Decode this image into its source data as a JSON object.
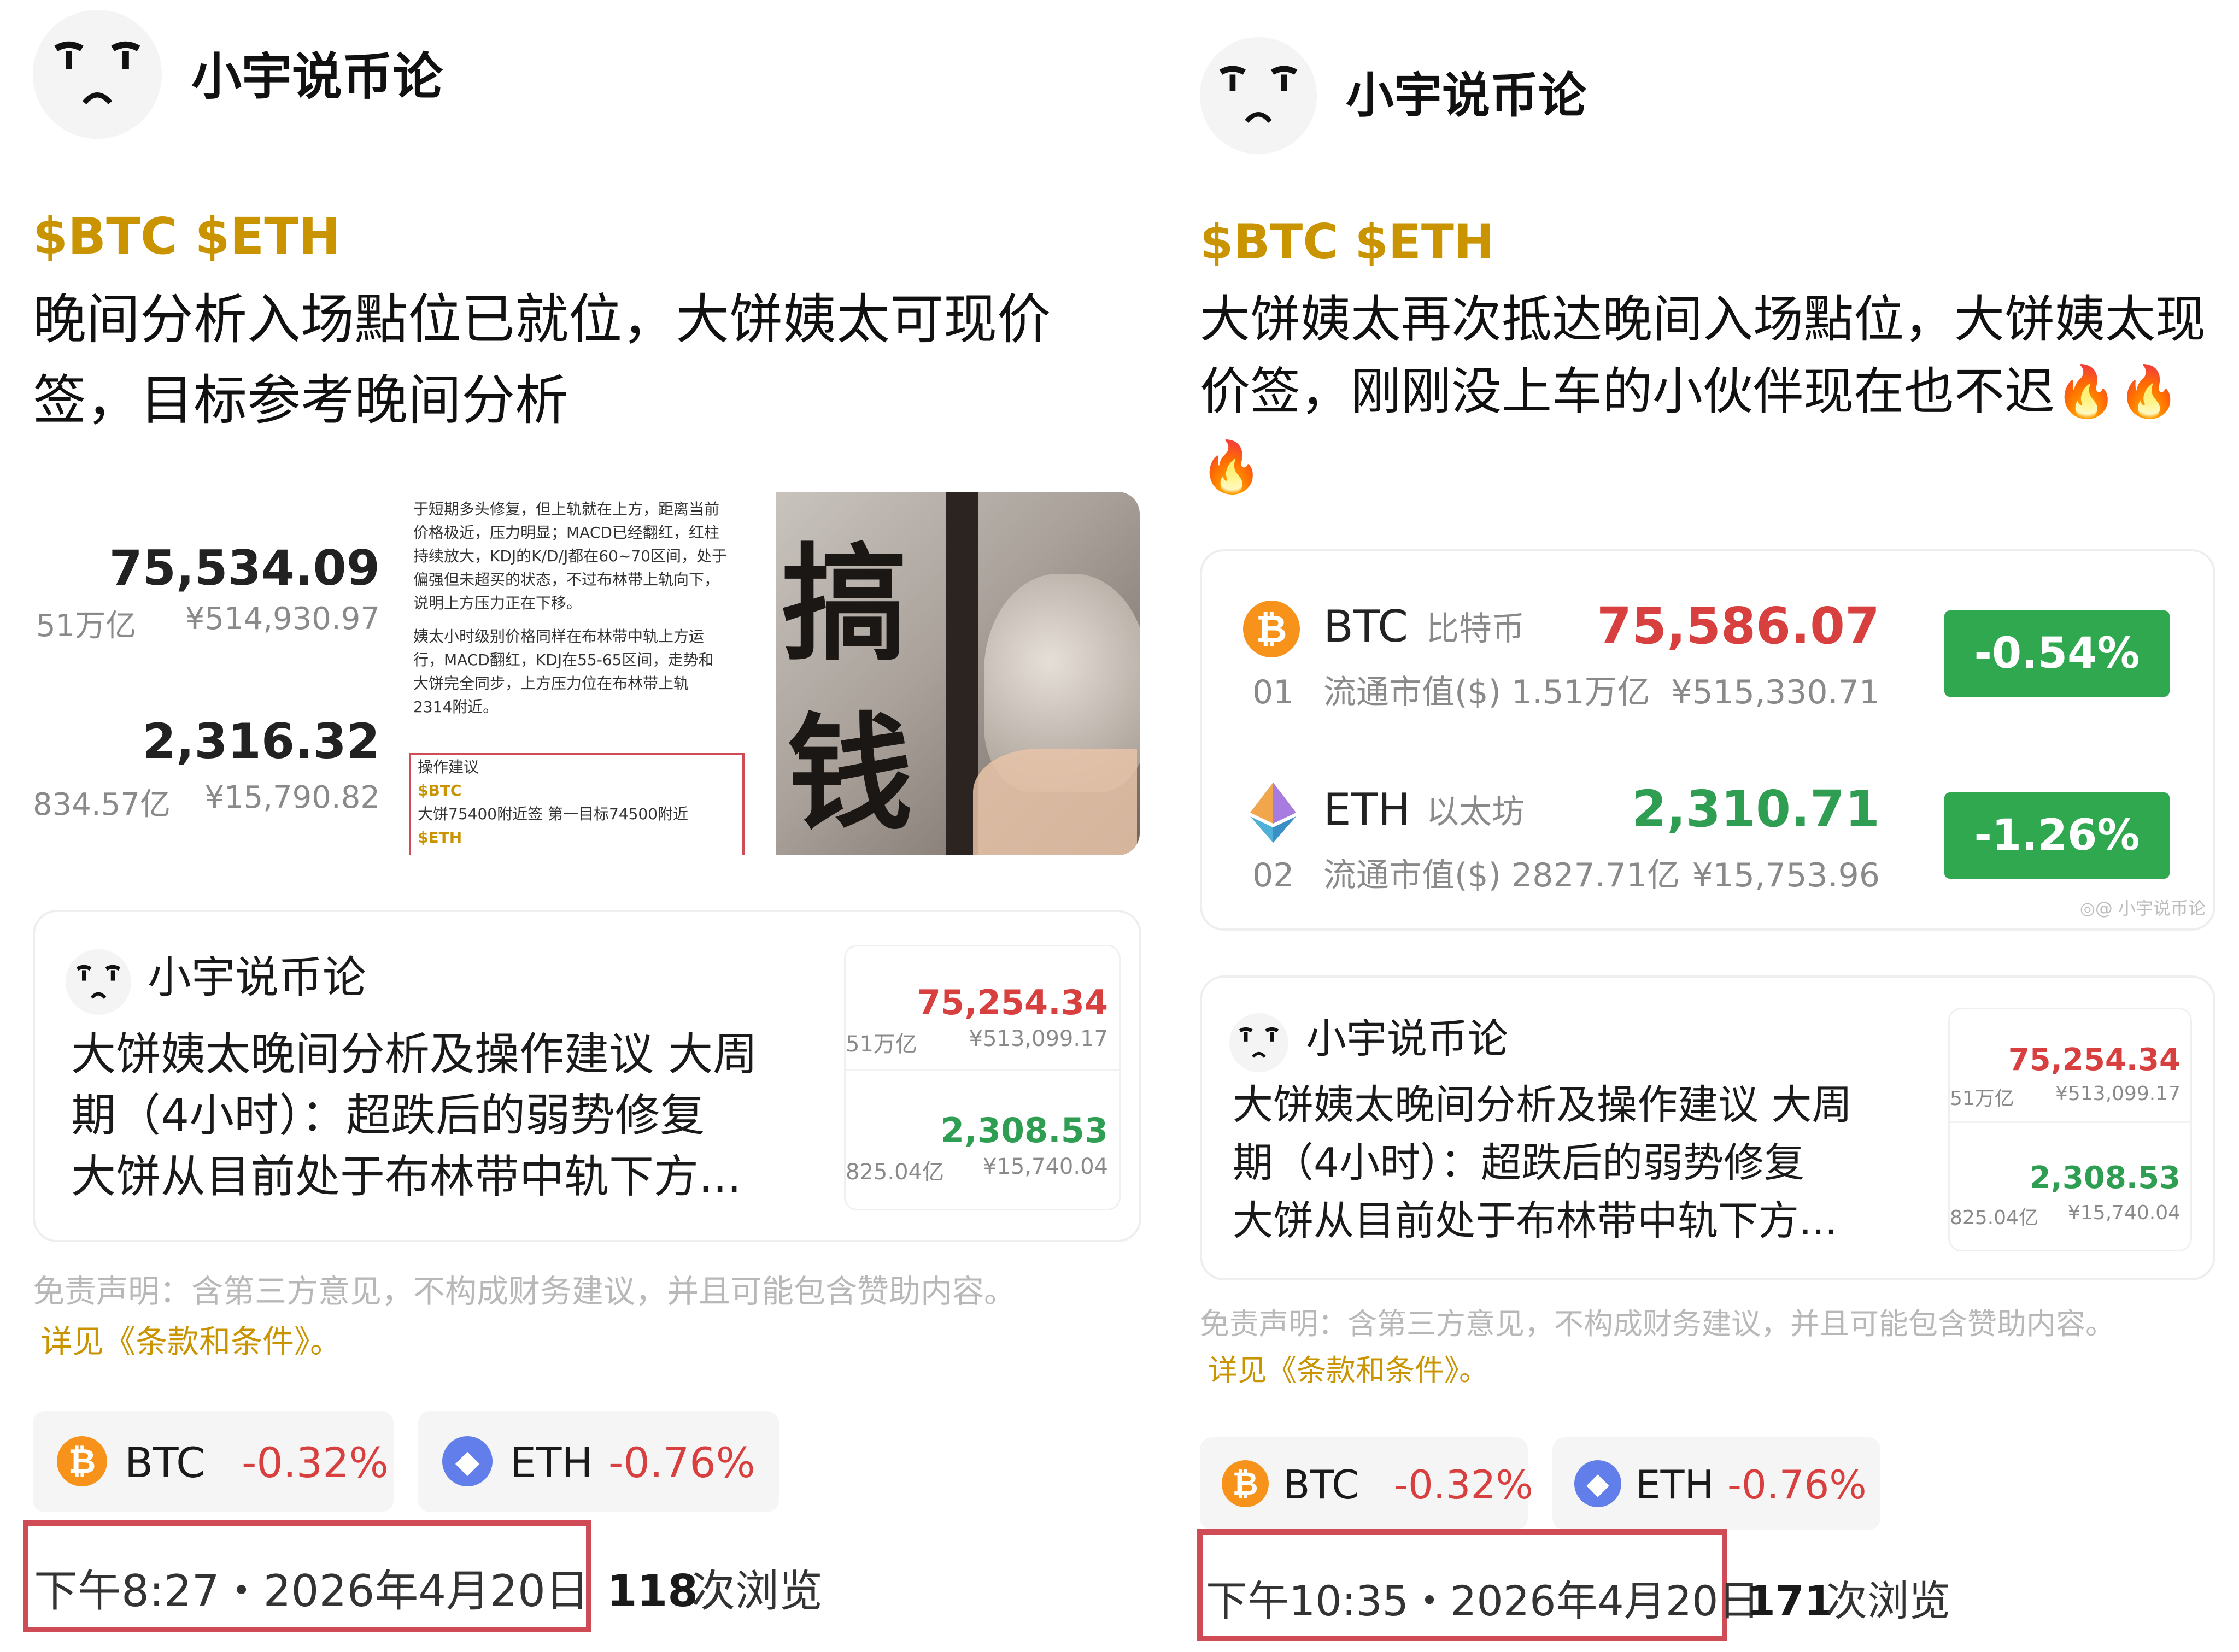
{
  "left": {
    "author": "小宇说币论",
    "tags": "$BTC $ETH",
    "post_lines": [
      "晚间分析入场點位已就位，大饼姨太可现价",
      "签，目标参考晚间分析"
    ],
    "thumb_market": {
      "btc_price": "75,534.09",
      "btc_cap": "51万亿",
      "btc_cny": "¥514,930.97",
      "eth_price": "2,316.32",
      "eth_cap": "834.57亿",
      "eth_cny": "¥15,790.82"
    },
    "thumb_text": {
      "para1": [
        "于短期多头修复，但上轨就在上方，距离当前",
        "价格极近，压力明显；MACD已经翻红，红柱",
        "持续放大，KDJ的K/D/J都在60~70区间，处于",
        "偏强但未超买的状态，不过布林带上轨向下，",
        "说明上方压力正在下移。"
      ],
      "para2": [
        "姨太小时级别价格同样在布林带中轨上方运",
        "行，MACD翻红，KDJ在55-65区间，走势和",
        "大饼完全同步，上方压力位在布林带上轨",
        "2314附近。"
      ],
      "box_title": "操作建议",
      "box_btc": "$BTC",
      "box_line": "大饼75400附近签 第一目标74500附近",
      "box_eth": "$ETH"
    },
    "thumb_art_chars": [
      "搞",
      "钱"
    ],
    "quote": {
      "author": "小宇说币论",
      "lines": [
        "大饼姨太晚间分析及操作建议 大周",
        "期（4小时）：超跌后的弱势修复",
        "大饼从目前处于布林带中轨下方..."
      ],
      "btc_price": "75,254.34",
      "btc_cap": "51万亿",
      "btc_cny": "¥513,099.17",
      "eth_price": "2,308.53",
      "eth_cap": "825.04亿",
      "eth_cny": "¥15,740.04"
    },
    "disclaimer": "免责声明：含第三方意见，不构成财务建议，并且可能包含赞助内容。",
    "terms": "详见《条款和条件》。",
    "chips": [
      {
        "symbol": "BTC",
        "change": "-0.32%"
      },
      {
        "symbol": "ETH",
        "change": "-0.76%"
      }
    ],
    "timestamp": "下午8:27・2026年4月20日",
    "views_count": "118",
    "views_label": "次浏览"
  },
  "right": {
    "author": "小宇说币论",
    "tags": "$BTC $ETH",
    "post_lines": [
      "大饼姨太再次抵达晚间入场點位，大饼姨太现",
      "价签，刚刚没上车的小伙伴现在也不迟🔥🔥",
      "🔥"
    ],
    "market": [
      {
        "rank": "01",
        "symbol": "BTC",
        "cn_name": "比特币",
        "cap": "流通市值($) 1.51万亿",
        "price": "75,586.07",
        "cny": "¥515,330.71",
        "change": "-0.54%"
      },
      {
        "rank": "02",
        "symbol": "ETH",
        "cn_name": "以太坊",
        "cap": "流通市值($) 2827.71亿",
        "price": "2,310.71",
        "cny": "¥15,753.96",
        "change": "-1.26%"
      }
    ],
    "watermark": "◎@ 小宇说币论",
    "quote": {
      "author": "小宇说币论",
      "lines": [
        "大饼姨太晚间分析及操作建议 大周",
        "期（4小时）：超跌后的弱势修复",
        "大饼从目前处于布林带中轨下方..."
      ],
      "btc_price": "75,254.34",
      "btc_cap": "51万亿",
      "btc_cny": "¥513,099.17",
      "eth_price": "2,308.53",
      "eth_cap": "825.04亿",
      "eth_cny": "¥15,740.04"
    },
    "disclaimer": "免责声明：含第三方意见，不构成财务建议，并且可能包含赞助内容。",
    "terms": "详见《条款和条件》。",
    "chips": [
      {
        "symbol": "BTC",
        "change": "-0.32%"
      },
      {
        "symbol": "ETH",
        "change": "-0.76%"
      }
    ],
    "timestamp": "下午10:35・2026年4月20日",
    "views_count": "171",
    "views_label": "次浏览"
  },
  "colors": {
    "tag_gold": "#c99400",
    "price_red": "#d84040",
    "price_green": "#2f9e52",
    "badge_green": "#2fa84f",
    "highlight_red": "#cf4b55",
    "btc_orange": "#f7931a",
    "eth_purple": "#627eea"
  },
  "icons": [
    "avatar-face-icon",
    "btc-coin-icon",
    "eth-coin-icon"
  ]
}
